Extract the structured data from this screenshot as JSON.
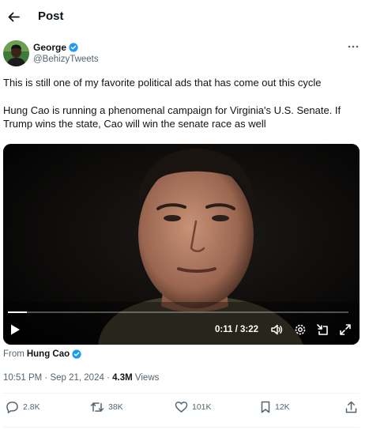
{
  "header": {
    "title": "Post"
  },
  "author": {
    "name": "George",
    "handle": "@BehizyTweets"
  },
  "tweet": {
    "line1": "This is still one of my favorite political ads that has come out this cycle",
    "line2": "Hung Cao is running a phenomenal campaign for Virginia's U.S. Senate. If",
    "line3": "Trump wins the state, Cao will win the senate race as well"
  },
  "video": {
    "time": "0:11 / 3:22",
    "progress": 0.055
  },
  "source": {
    "prefix": "From",
    "name": "Hung Cao"
  },
  "meta": {
    "datetime": "10:51 PM · Sep 21, 2024",
    "sep": "·",
    "views_count": "4.3M",
    "views_label": "Views"
  },
  "actions": {
    "replies": "2.8K",
    "reposts": "38K",
    "likes": "101K",
    "bookmarks": "12K"
  },
  "colors": {
    "verified": "#1d9bf0",
    "secondary": "#536471",
    "divider": "#eff3f4"
  }
}
